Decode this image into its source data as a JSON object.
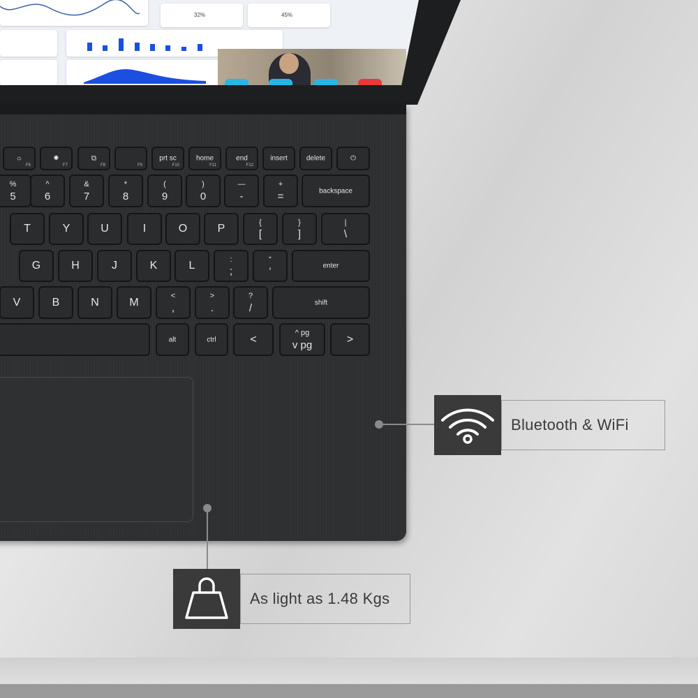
{
  "screen": {
    "dashboard_percentages": [
      "32%",
      "45%"
    ],
    "accent": "#1a4fe0"
  },
  "keyboard": {
    "function_row": [
      {
        "icon": "brightness-down-icon",
        "fn": "F6"
      },
      {
        "icon": "brightness-up-icon",
        "fn": "F7"
      },
      {
        "icon": "display-switch-icon",
        "fn": "F8"
      },
      {
        "label": "",
        "fn": "F9"
      },
      {
        "label": "prt sc",
        "fn": "F10"
      },
      {
        "label": "home",
        "fn": "F11"
      },
      {
        "label": "end",
        "fn": "F12"
      },
      {
        "label": "insert"
      },
      {
        "label": "delete"
      },
      {
        "icon": "power-icon"
      }
    ],
    "number_row": [
      {
        "t": "%",
        "b": "5"
      },
      {
        "t": "^",
        "b": "6"
      },
      {
        "t": "&",
        "b": "7"
      },
      {
        "t": "*",
        "b": "8"
      },
      {
        "t": "(",
        "b": "9"
      },
      {
        "t": ")",
        "b": "0"
      },
      {
        "t": "—",
        "b": "-"
      },
      {
        "t": "+",
        "b": "="
      },
      {
        "c": "backspace"
      }
    ],
    "top_row": [
      {
        "c": "T"
      },
      {
        "c": "Y"
      },
      {
        "c": "U"
      },
      {
        "c": "I"
      },
      {
        "c": "O"
      },
      {
        "c": "P"
      },
      {
        "t": "{",
        "b": "["
      },
      {
        "t": "}",
        "b": "]"
      },
      {
        "t": "|",
        "b": "\\"
      }
    ],
    "home_row": [
      {
        "c": "G"
      },
      {
        "c": "H"
      },
      {
        "c": "J"
      },
      {
        "c": "K"
      },
      {
        "c": "L"
      },
      {
        "t": ":",
        "b": ";"
      },
      {
        "t": "“",
        "b": "‘"
      },
      {
        "c": "enter"
      }
    ],
    "bottom_row": [
      {
        "c": "V"
      },
      {
        "c": "B"
      },
      {
        "c": "N"
      },
      {
        "c": "M"
      },
      {
        "t": "<",
        "b": ","
      },
      {
        "t": ">",
        "b": "."
      },
      {
        "t": "?",
        "b": "/"
      },
      {
        "c": "shift"
      }
    ],
    "space_row": [
      {
        "c": ""
      },
      {
        "c": "alt"
      },
      {
        "c": "ctrl"
      },
      {
        "c": "<"
      },
      {
        "t": "^ pg",
        "b": "v pg"
      },
      {
        "c": ">"
      }
    ]
  },
  "callouts": [
    {
      "icon": "wifi-icon",
      "text": "Bluetooth & WiFi"
    },
    {
      "icon": "shopping-bag-icon",
      "text": "As light as 1.48 Kgs"
    }
  ]
}
